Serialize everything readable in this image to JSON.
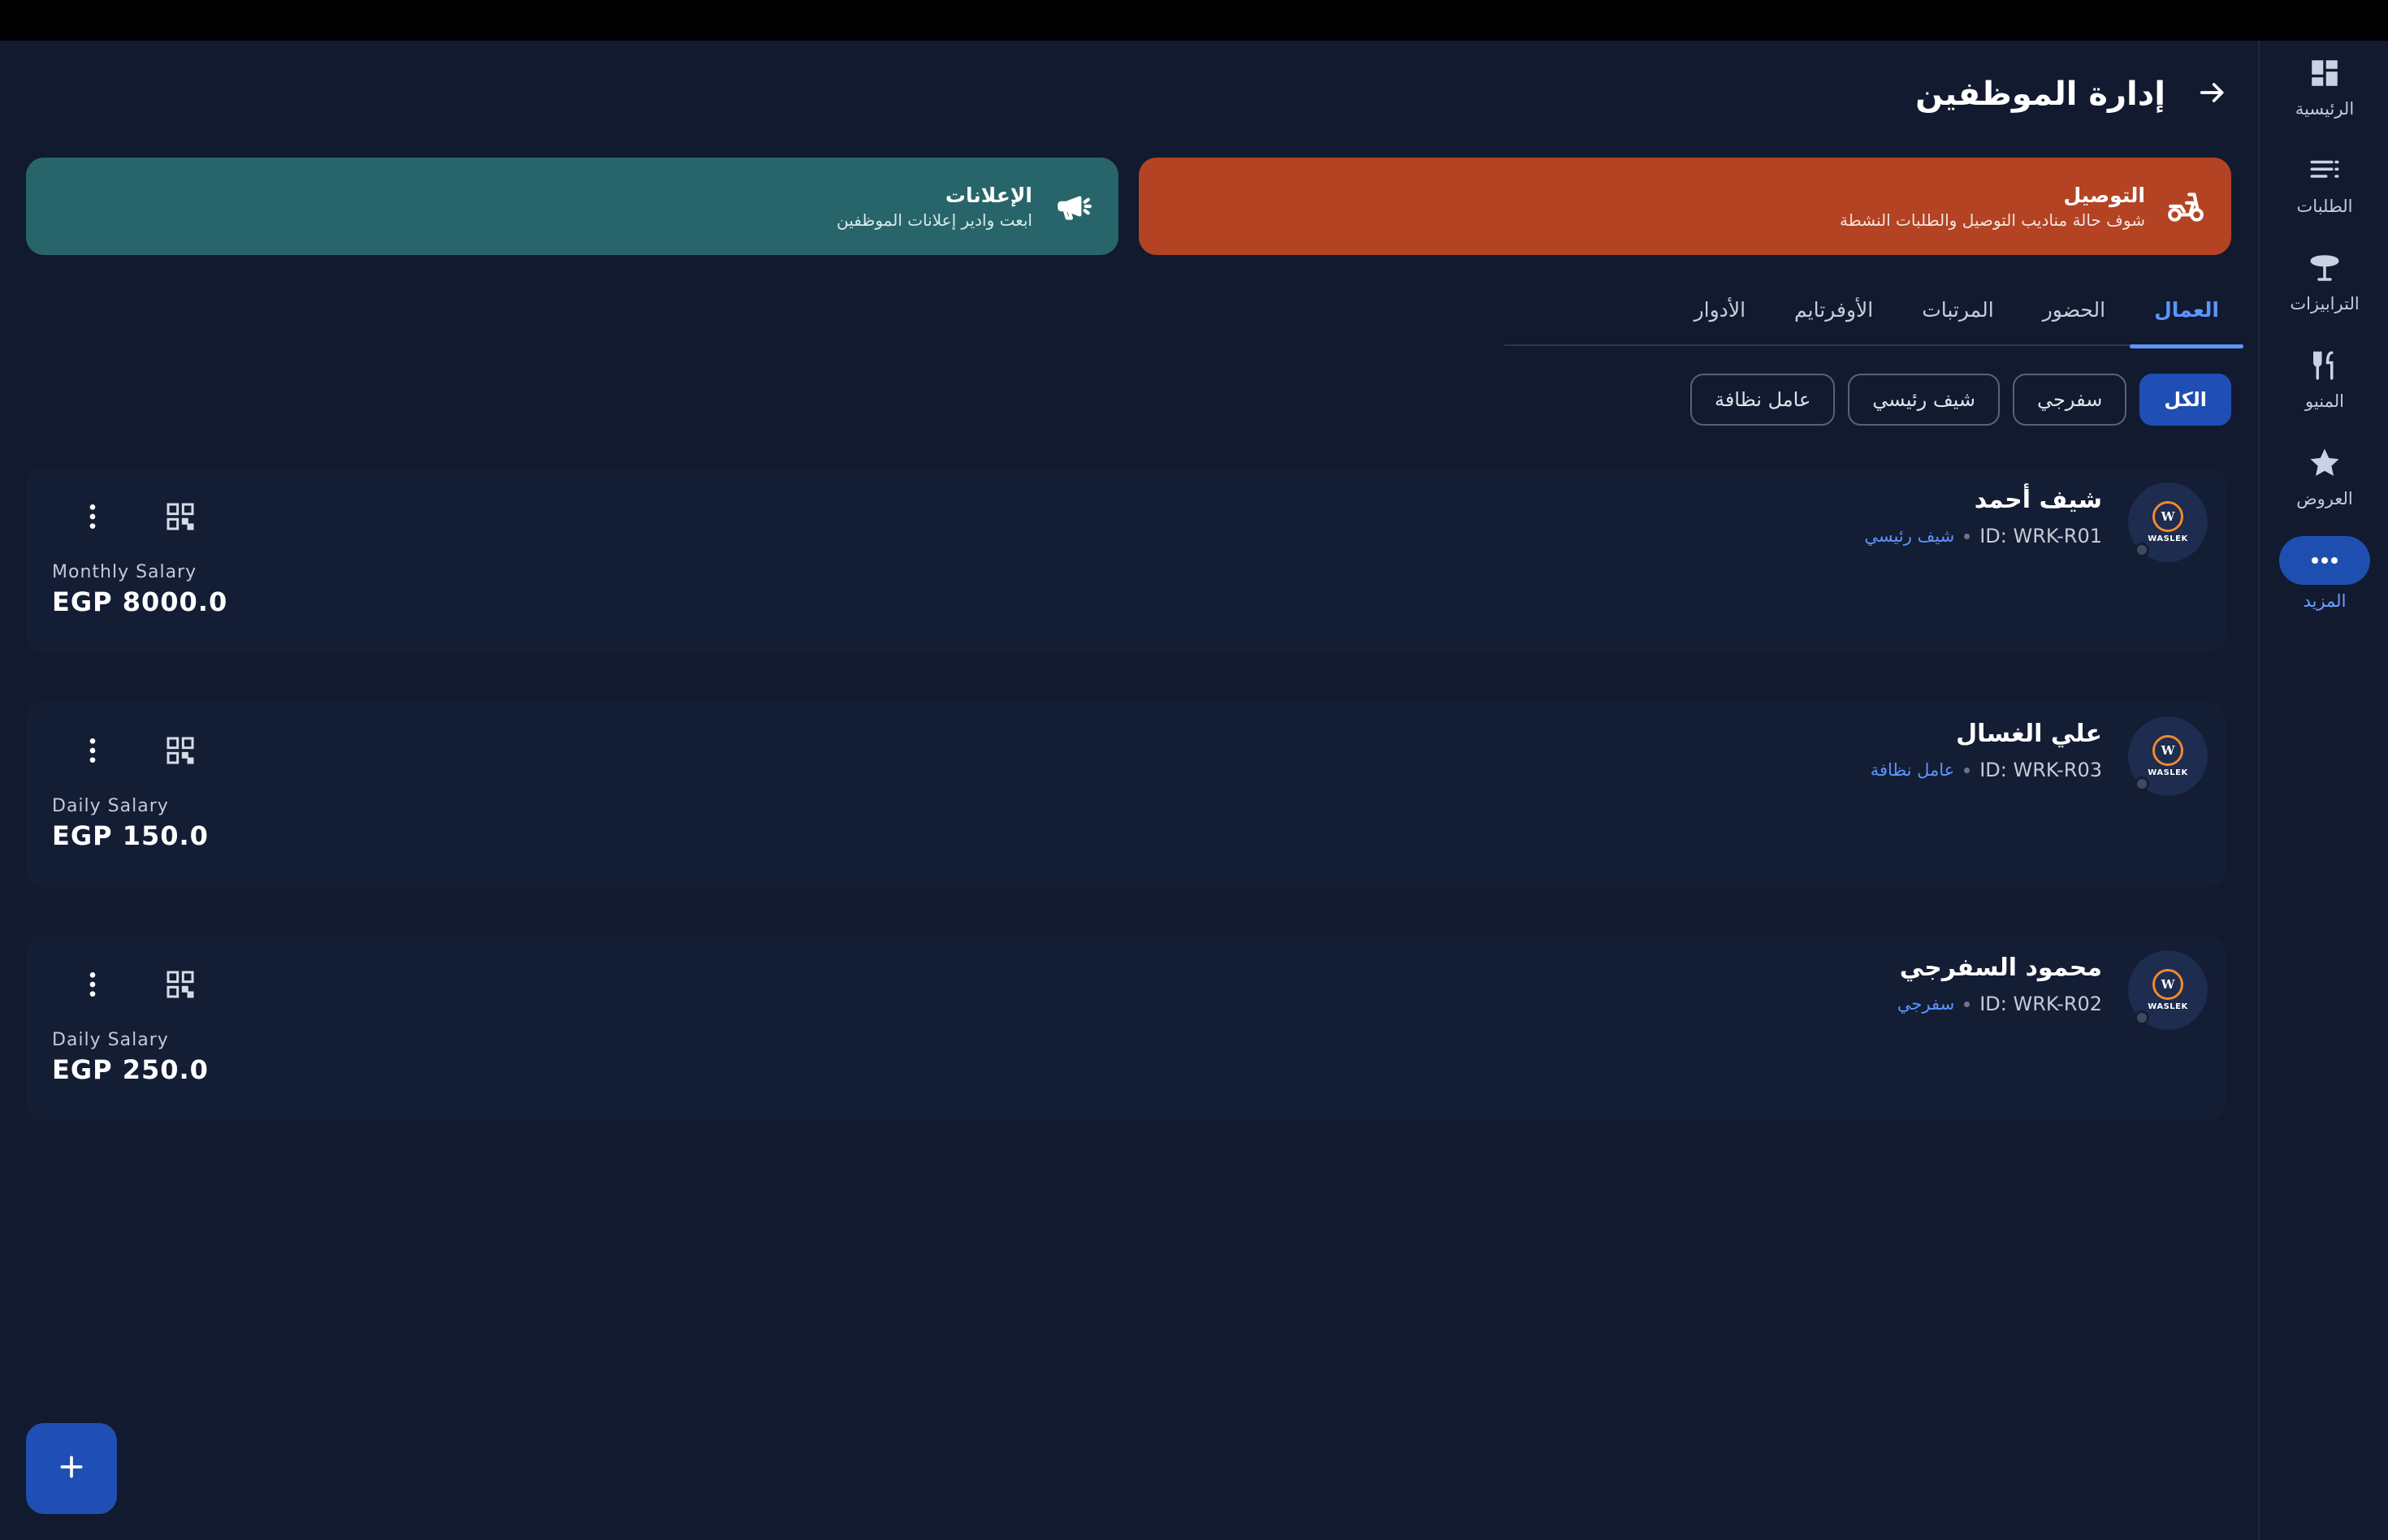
{
  "header": {
    "title": "إدارة الموظفين",
    "back_icon": "arrow-right-icon"
  },
  "quick_cards": {
    "delivery": {
      "title": "التوصيل",
      "subtitle": "شوف حالة مناديب التوصيل والطلبات النشطة",
      "icon": "delivery-scooter-icon",
      "color": "#b34323"
    },
    "ads": {
      "title": "الإعلانات",
      "subtitle": "ابعت وادير إعلانات الموظفين",
      "icon": "megaphone-icon",
      "color": "#28656a"
    }
  },
  "tabs": [
    {
      "label": "العمال",
      "active": true
    },
    {
      "label": "الحضور",
      "active": false
    },
    {
      "label": "المرتبات",
      "active": false
    },
    {
      "label": "الأوفرتايم",
      "active": false
    },
    {
      "label": "الأدوار",
      "active": false
    }
  ],
  "filters": [
    {
      "label": "الكل",
      "active": true
    },
    {
      "label": "سفرجي",
      "active": false
    },
    {
      "label": "شيف رئيسي",
      "active": false
    },
    {
      "label": "عامل نظافة",
      "active": false
    }
  ],
  "employees": [
    {
      "name": "شيف أحمد",
      "id": "ID: WRK-R01",
      "role": "شيف رئيسي",
      "salary_label": "Monthly Salary",
      "salary": "EGP 8000.0"
    },
    {
      "name": "علي الغسال",
      "id": "ID: WRK-R03",
      "role": "عامل نظافة",
      "salary_label": "Daily Salary",
      "salary": "EGP 150.0"
    },
    {
      "name": "محمود السفرجي",
      "id": "ID: WRK-R02",
      "role": "سفرجي",
      "salary_label": "Daily Salary",
      "salary": "EGP 250.0"
    }
  ],
  "avatar_logo": {
    "mark": "W",
    "text": "WASLEK"
  },
  "nav": [
    {
      "label": "الرئيسية",
      "icon": "dashboard-icon",
      "active": false
    },
    {
      "label": "الطلبات",
      "icon": "list-icon",
      "active": false
    },
    {
      "label": "الترابيزات",
      "icon": "table-icon",
      "active": false
    },
    {
      "label": "المنيو",
      "icon": "fork-knife-icon",
      "active": false
    },
    {
      "label": "العروض",
      "icon": "star-icon",
      "active": false
    },
    {
      "label": "المزيد",
      "icon": "more-dots-icon",
      "active": true
    }
  ],
  "fab": {
    "icon": "plus-icon"
  },
  "colors": {
    "background": "#111a2f",
    "accent": "#5d95ff",
    "primary": "#1f4fb4"
  }
}
